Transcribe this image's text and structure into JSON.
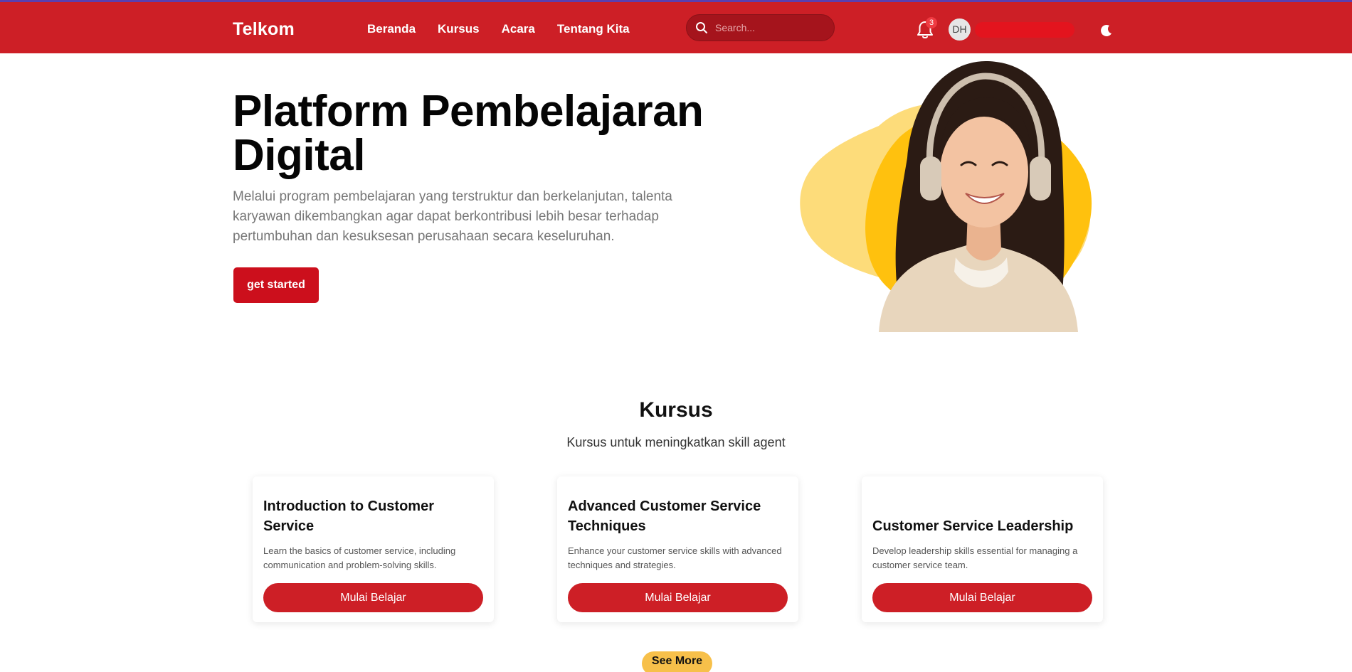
{
  "colors": {
    "navbar": "#cd1f26",
    "primary_button": "#cc0f1c",
    "accent_yellow": "#f7c04a"
  },
  "navbar": {
    "brand": "Telkom",
    "links": [
      "Beranda",
      "Kursus",
      "Acara",
      "Tentang Kita"
    ],
    "search_placeholder": "Search...",
    "search_icon": "search-icon",
    "notifications_icon": "bell-icon",
    "notifications_count": "3",
    "avatar_initials": "DH",
    "theme_icon": "moon-icon"
  },
  "hero": {
    "title": "Platform Pembelajaran Digital",
    "description": "Melalui program pembelajaran yang terstruktur dan berkelanjutan, talenta karyawan dikembangkan agar dapat berkontribusi lebih besar terhadap pertumbuhan dan kesuksesan perusahaan secara keseluruhan.",
    "cta_label": "get started"
  },
  "courses": {
    "title": "Kursus",
    "subtitle": "Kursus untuk meningkatkan skill agent",
    "items": [
      {
        "title": "Introduction to Customer Service",
        "description": "Learn the basics of customer service, including communication and problem-solving skills.",
        "button": "Mulai Belajar"
      },
      {
        "title": "Advanced Customer Service Techniques",
        "description": "Enhance your customer service skills with advanced techniques and strategies.",
        "button": "Mulai Belajar"
      },
      {
        "title": "Customer Service Leadership",
        "description": "Develop leadership skills essential for managing a customer service team.",
        "button": "Mulai Belajar"
      }
    ],
    "see_more_label": "See More"
  }
}
